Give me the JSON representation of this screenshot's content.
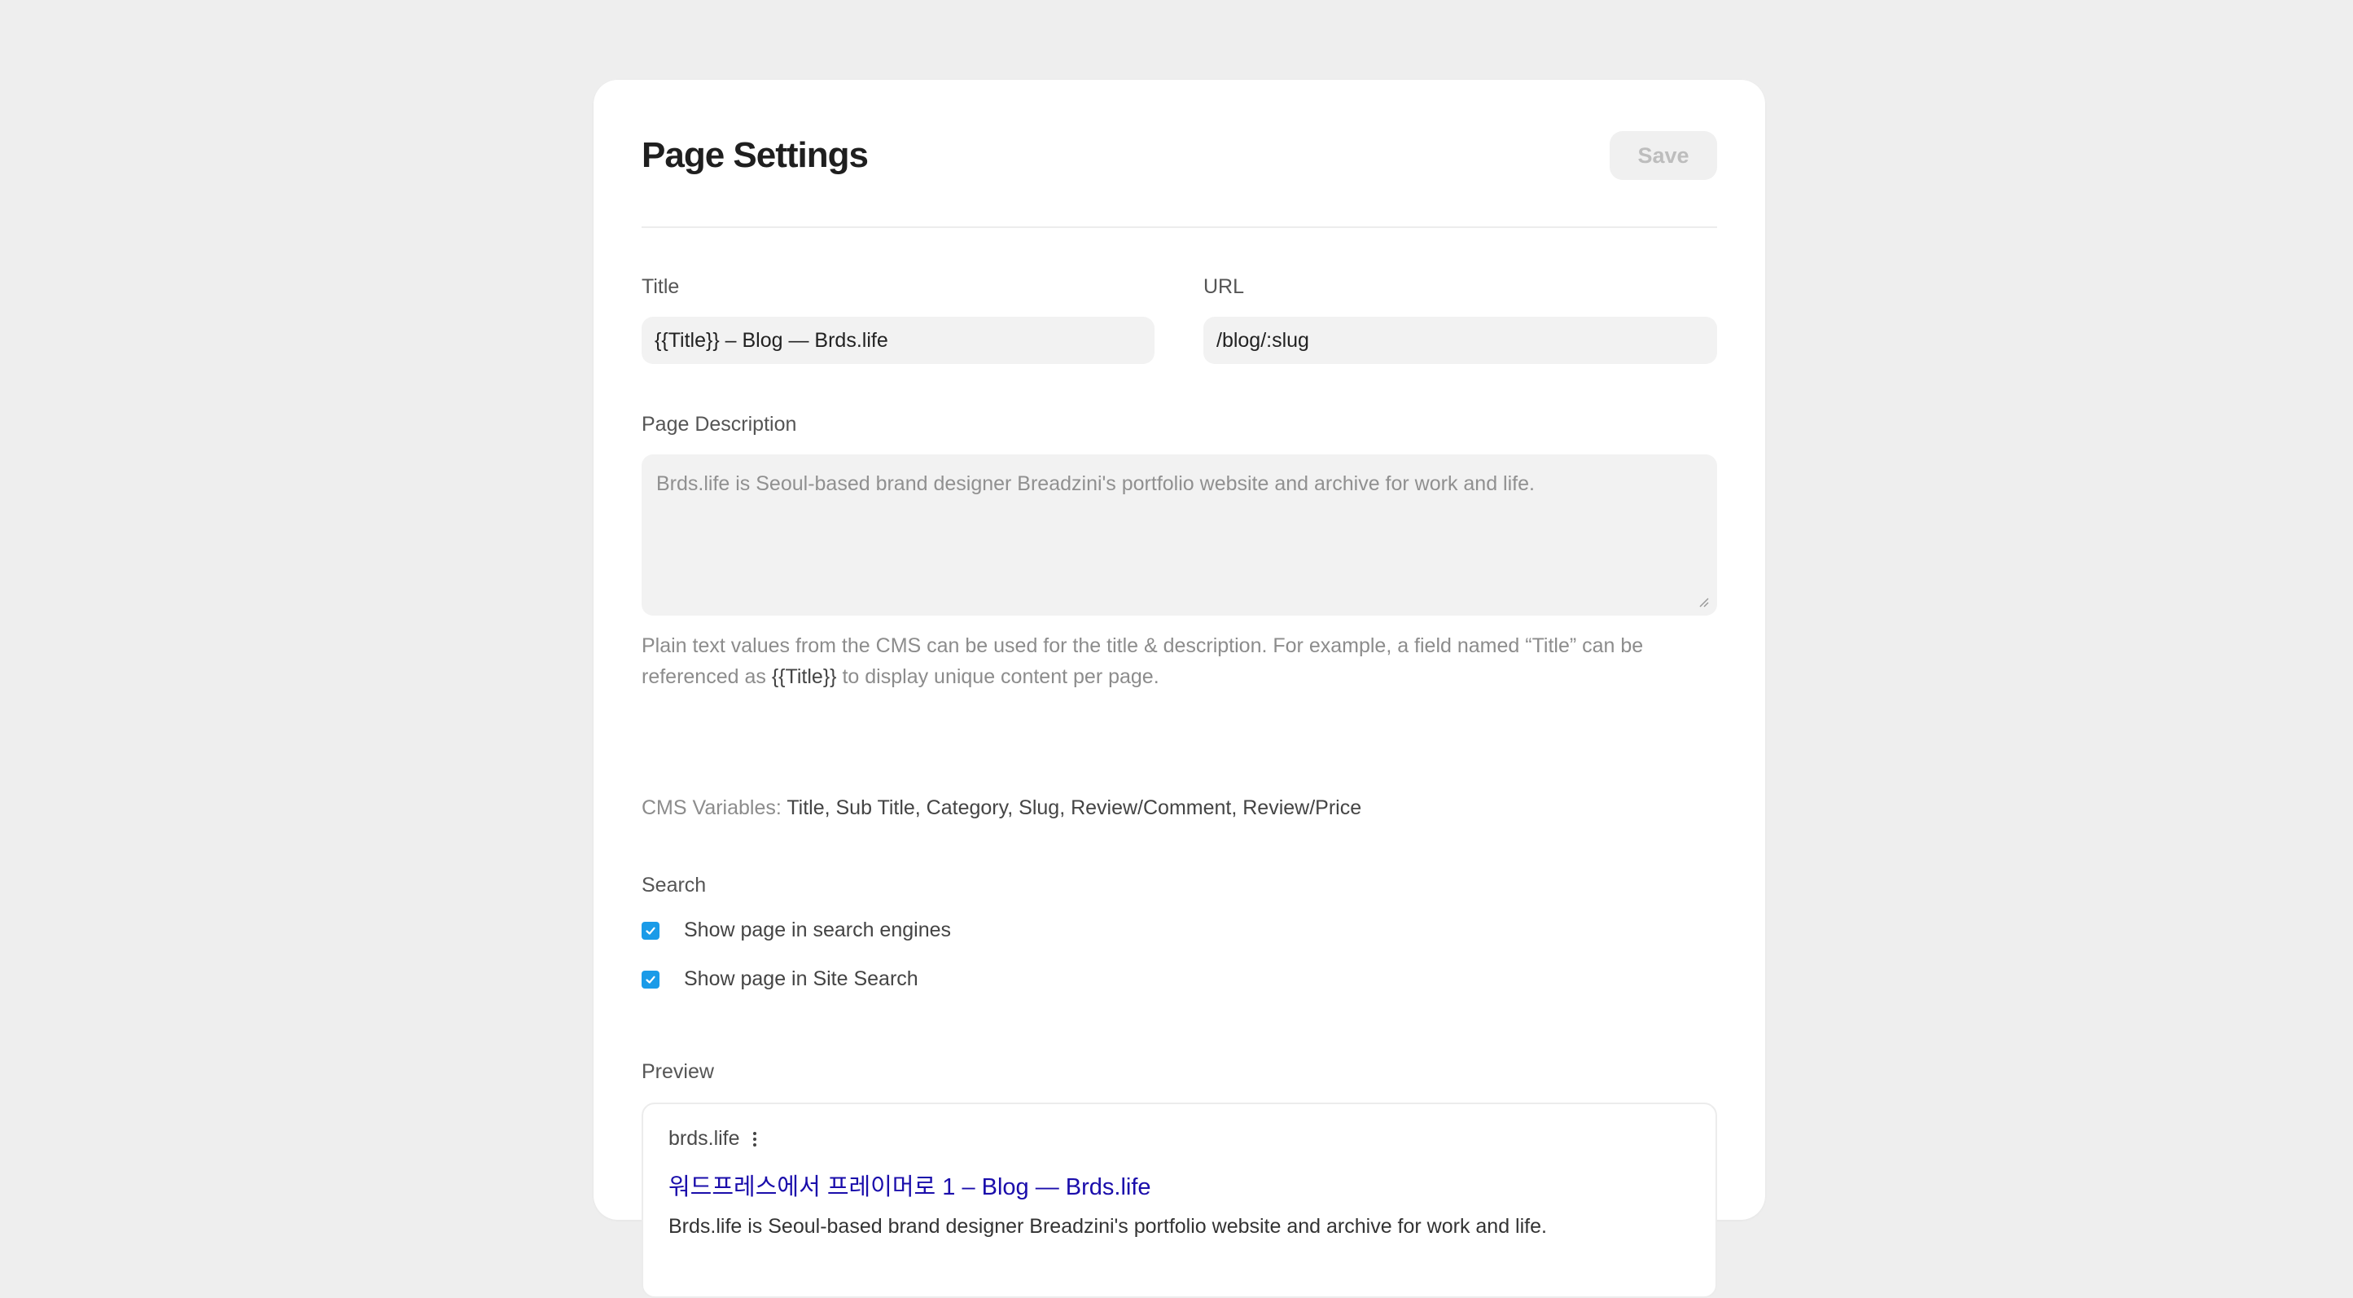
{
  "header": {
    "title": "Page Settings",
    "save_label": "Save"
  },
  "fields": {
    "title_label": "Title",
    "title_value": "{{Title}} – Blog — Brds.life",
    "url_label": "URL",
    "url_value": "/blog/:slug",
    "description_label": "Page Description",
    "description_placeholder": "Brds.life is Seoul-based brand designer Breadzini's portfolio website and archive for work and life."
  },
  "help": {
    "text_before": "Plain text values from the CMS can be used for the title & description. For example, a field named “Title” can be referenced as ",
    "code": "{{Title}}",
    "text_after": " to display unique content per page.",
    "vars_label": "CMS Variables: ",
    "vars_list": "Title, Sub Title, Category, Slug, Review/Comment, Review/Price"
  },
  "search": {
    "label": "Search",
    "options": [
      {
        "label": "Show page in search engines",
        "checked": true
      },
      {
        "label": "Show page in Site Search",
        "checked": true
      }
    ]
  },
  "preview": {
    "label": "Preview",
    "site": "brds.life",
    "title": "워드프레스에서 프레이머로 1 – Blog — Brds.life",
    "description": "Brds.life is Seoul-based brand designer Breadzini's portfolio website and archive for work and life."
  },
  "colors": {
    "background": "#eeeeee",
    "checkbox": "#1a9be8",
    "link": "#1a0dab"
  }
}
